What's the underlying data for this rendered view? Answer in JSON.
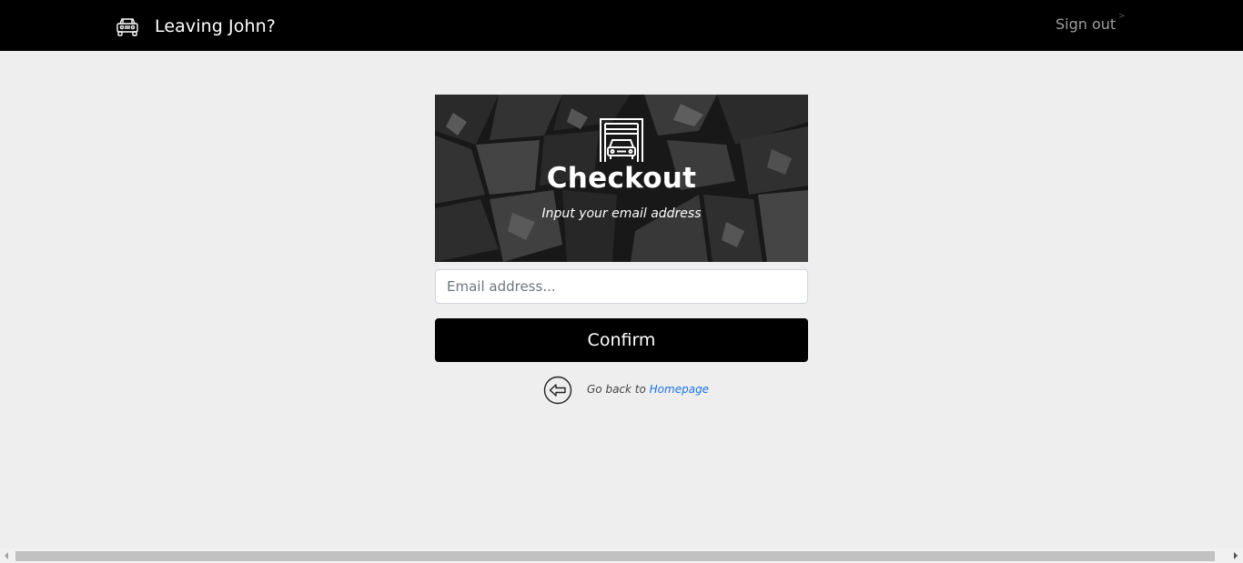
{
  "navbar": {
    "brand_text": "Leaving John?",
    "brand_icon": "jeep-icon",
    "signout_label": "Sign out",
    "signout_caret": ">"
  },
  "hero": {
    "icon": "garage-car-icon",
    "title": "Checkout",
    "subtitle": "Input your email address"
  },
  "form": {
    "email_value": "",
    "email_placeholder": "Email address...",
    "confirm_label": "Confirm"
  },
  "footer_nav": {
    "back_icon": "arrow-left-circle-icon",
    "back_prefix": "Go back to ",
    "back_link": "Homepage"
  },
  "colors": {
    "navbar_bg": "#000000",
    "page_bg": "#eeeeee",
    "button_bg": "#000000",
    "link": "#1a73e8",
    "signout": "#9e9e9e"
  }
}
